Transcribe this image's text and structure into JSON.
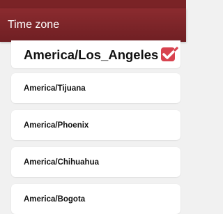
{
  "header": {
    "title": "Time zone"
  },
  "timezones": {
    "selected": "America/Los_Angeles",
    "items": [
      "America/Los_Angeles",
      "America/Tijuana",
      "America/Phoenix",
      "America/Chihuahua",
      "America/Bogota"
    ]
  },
  "colors": {
    "accent": "#7a2326",
    "check": "#d8434f"
  },
  "icons": {
    "selected_marker": "checkbox-checked-icon"
  }
}
